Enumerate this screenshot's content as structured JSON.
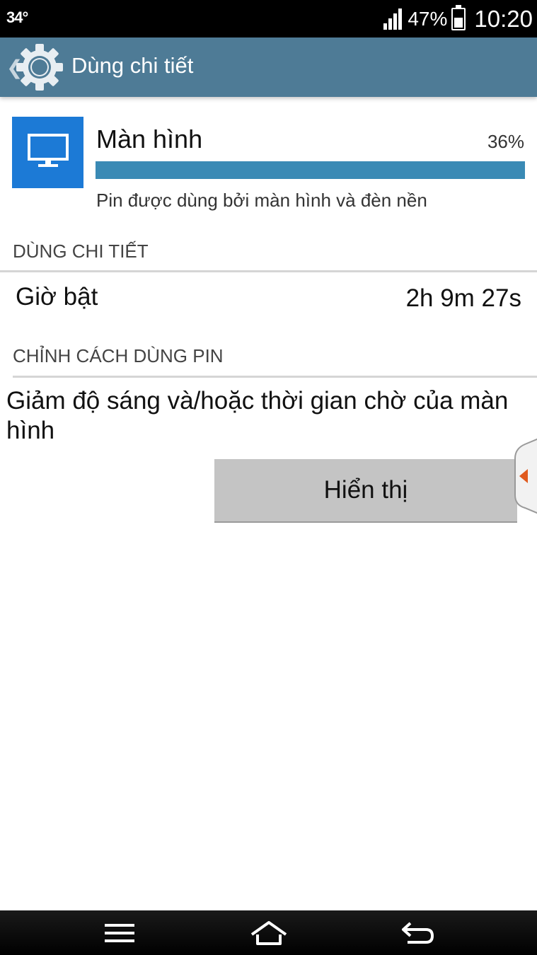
{
  "status_bar": {
    "temperature": "34°",
    "battery_percent": "47%",
    "battery_level": 0.47,
    "time": "10:20"
  },
  "action_bar": {
    "title": "Dùng chi tiết",
    "icons": [
      "back-chevron-icon",
      "gear-icon"
    ]
  },
  "usage": {
    "name": "Màn hình",
    "percent_label": "36%",
    "percent": 36,
    "description": "Pin được dùng bởi màn hình và đèn nền",
    "icon": "monitor-icon",
    "tile_color": "#1c7ad6",
    "bar_color": "#3a8ab5"
  },
  "details": {
    "header": "DÙNG CHI TIẾT",
    "on_time_label": "Giờ bật",
    "on_time_value": "2h 9m 27s"
  },
  "adjust": {
    "header": "CHỈNH CÁCH DÙNG PIN",
    "advice": "Giảm độ sáng và/hoặc thời gian chờ của màn hình",
    "button_label": "Hiển thị"
  },
  "nav_bar": {
    "icons": [
      "menu-icon",
      "home-icon",
      "back-icon"
    ]
  },
  "colors": {
    "action_bar": "#4e7b96",
    "side_tab_arrow": "#e05a1e"
  }
}
